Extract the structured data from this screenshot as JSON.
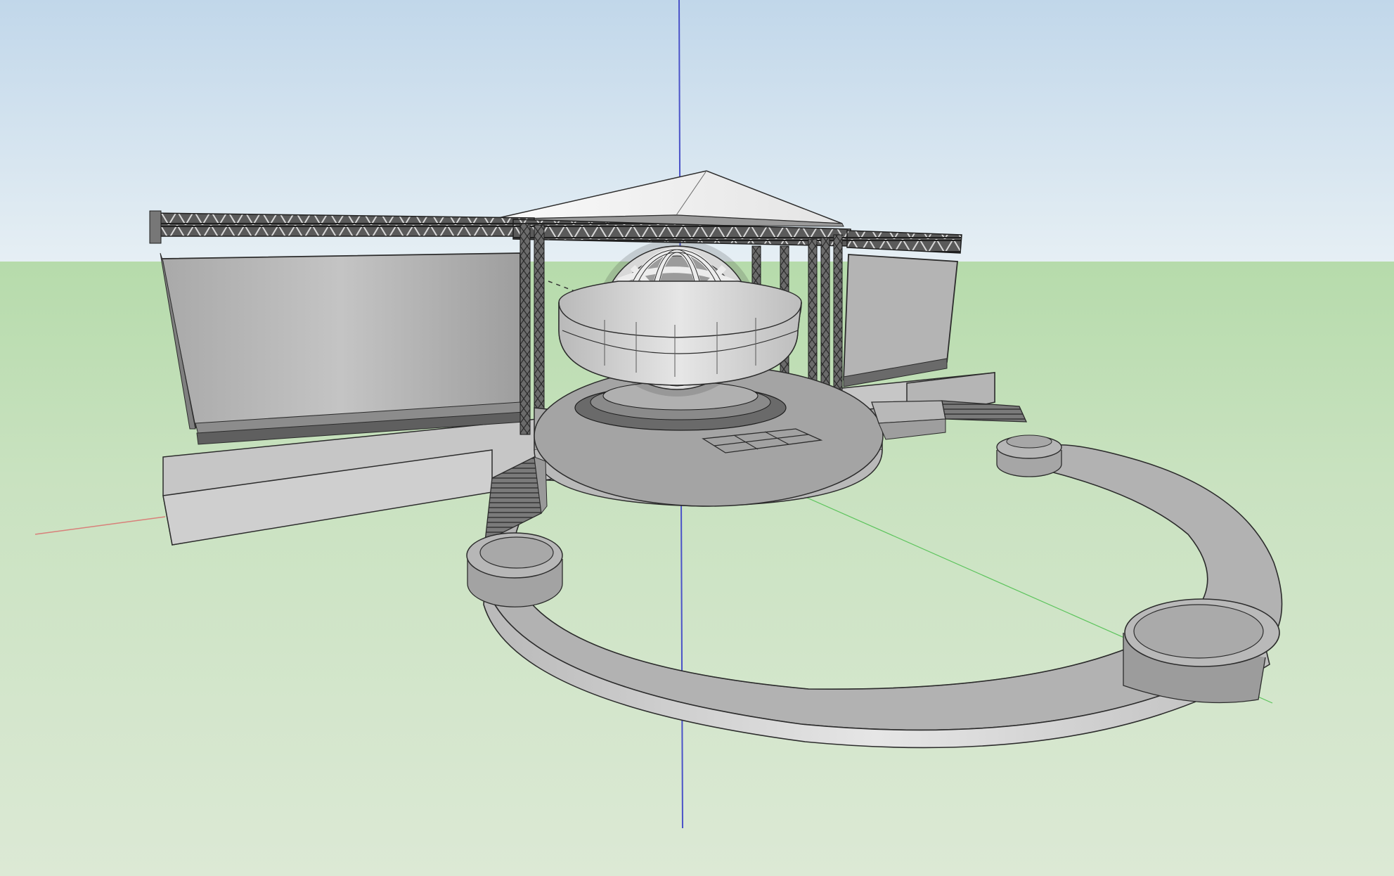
{
  "viewport": {
    "view": "3d-model-viewport",
    "sky_top_color": "#c1d7ea",
    "sky_horizon_color": "#e6eff4",
    "ground_near_color": "#dce9d5",
    "ground_far_color": "#b6dbab",
    "axis_colors": {
      "red": "#d8807a",
      "green": "#5cc45c",
      "blue": "#4a52c8"
    }
  },
  "model": {
    "material_color": "#c9c9c9",
    "edge_color": "#2c2c2c",
    "components": [
      "canopy-roof",
      "truss-frame",
      "left-led-screen",
      "right-led-screen",
      "rear-platform",
      "central-globe-sculpture",
      "globe-ring",
      "round-stage",
      "floor-panels",
      "left-staircase",
      "right-staircase",
      "ring-runway",
      "runway-left-pad",
      "runway-right-pad",
      "runway-top-pad"
    ]
  }
}
